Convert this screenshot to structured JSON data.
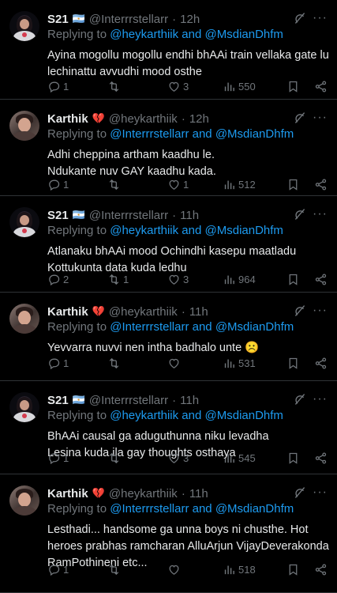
{
  "tweets": [
    {
      "name": "S21",
      "badge": "🇦🇷",
      "handle": "@Interrrstellarr",
      "time": "12h",
      "replying_prefix": "Replying to",
      "replying_mentions": "@heykarthiik and @MsdianDhfm",
      "lines": [
        "Ayina mogollu mogollu endhi bhAAi train vellaka gate lu",
        "lechinattu avvudhi mood osthe"
      ],
      "replies": "1",
      "retweets": "",
      "likes": "3",
      "views": "550",
      "avatar": "s21"
    },
    {
      "name": "Karthik",
      "badge": "💔",
      "handle": "@heykarthiik",
      "time": "12h",
      "replying_prefix": "Replying to",
      "replying_mentions": "@Interrrstellarr and @MsdianDhfm",
      "lines": [
        "Adhi cheppina artham kaadhu le.",
        "Ndukante nuv GAY kaadhu kada."
      ],
      "replies": "1",
      "retweets": "",
      "likes": "1",
      "views": "512",
      "avatar": "karthik"
    },
    {
      "name": "S21",
      "badge": "🇦🇷",
      "handle": "@Interrrstellarr",
      "time": "11h",
      "replying_prefix": "Replying to",
      "replying_mentions": "@heykarthiik and @MsdianDhfm",
      "lines": [
        "Atlanaku bhAAi mood Ochindhi kasepu maatladu",
        "Kottukunta data kuda ledhu"
      ],
      "replies": "2",
      "retweets": "1",
      "likes": "3",
      "views": "964",
      "avatar": "s21"
    },
    {
      "name": "Karthik",
      "badge": "💔",
      "handle": "@heykarthiik",
      "time": "11h",
      "replying_prefix": "Replying to",
      "replying_mentions": "@Interrrstellarr and @MsdianDhfm",
      "lines": [
        "Yevvarra nuvvi nen intha badhalo unte ☹️"
      ],
      "replies": "1",
      "retweets": "",
      "likes": "",
      "views": "531",
      "avatar": "karthik"
    },
    {
      "name": "S21",
      "badge": "🇦🇷",
      "handle": "@Interrrstellarr",
      "time": "11h",
      "replying_prefix": "Replying to",
      "replying_mentions": "@heykarthiik and @MsdianDhfm",
      "lines": [
        "BhAAi causal ga aduguthunna niku levadha",
        "Lesina kuda ila gay thoughts osthaya"
      ],
      "replies": "1",
      "retweets": "",
      "likes": "3",
      "views": "545",
      "avatar": "s21"
    },
    {
      "name": "Karthik",
      "badge": "💔",
      "handle": "@heykarthiik",
      "time": "11h",
      "replying_prefix": "Replying to",
      "replying_mentions": "@Interrrstellarr and @MsdianDhfm",
      "lines": [
        "Lesthadi... handsome ga unna boys ni chusthe. Hot",
        "heroes prabhas ramcharan AlluArjun VijayDeverakonda",
        "RamPothineni etc..."
      ],
      "replies": "1",
      "retweets": "",
      "likes": "",
      "views": "518",
      "avatar": "karthik"
    }
  ],
  "icons": {
    "reply": "reply-icon",
    "retweet": "retweet-icon",
    "like": "heart-icon",
    "views": "views-icon",
    "bookmark": "bookmark-icon",
    "share": "share-icon",
    "grok": "grok-icon",
    "more": "more-icon"
  },
  "colors": {
    "background": "#000000",
    "text": "#e7e9ea",
    "muted": "#71767b",
    "link": "#1d9bf0",
    "divider": "#2f3336"
  }
}
